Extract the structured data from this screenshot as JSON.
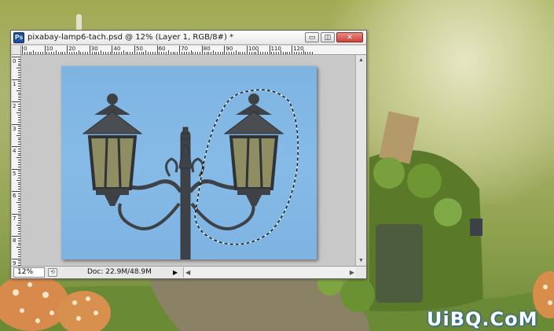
{
  "window": {
    "title": "pixabay-lamp6-tach.psd @ 12% (Layer 1, RGB/8#) *",
    "app_icon_label": "Ps",
    "minimize_glyph": "▭",
    "maximize_glyph": "◫",
    "close_glyph": "✕"
  },
  "ruler": {
    "horizontal_labels": [
      "0",
      "10",
      "20",
      "30",
      "40",
      "50",
      "60",
      "70",
      "80",
      "90",
      "100",
      "110",
      "120"
    ],
    "vertical_labels": [
      "0",
      "1",
      "2",
      "3",
      "4",
      "5",
      "6",
      "7",
      "8",
      "9"
    ]
  },
  "status": {
    "zoom": "12%",
    "doc_info": "Doc: 22.9M/48.9M",
    "menu_arrow": "▶"
  },
  "scrollbar": {
    "up": "▲",
    "down": "▼",
    "left": "◀",
    "right": "▶"
  },
  "watermark": {
    "text": "UiBQ.CoM"
  },
  "colors": {
    "sky": "#7eb4e2",
    "lamp_metal": "#3e4247",
    "lamp_glass": "#8f8e62",
    "selection": "#ffffff",
    "close_button": "#c9443a",
    "watermark_stroke": "#1d5fa8"
  }
}
